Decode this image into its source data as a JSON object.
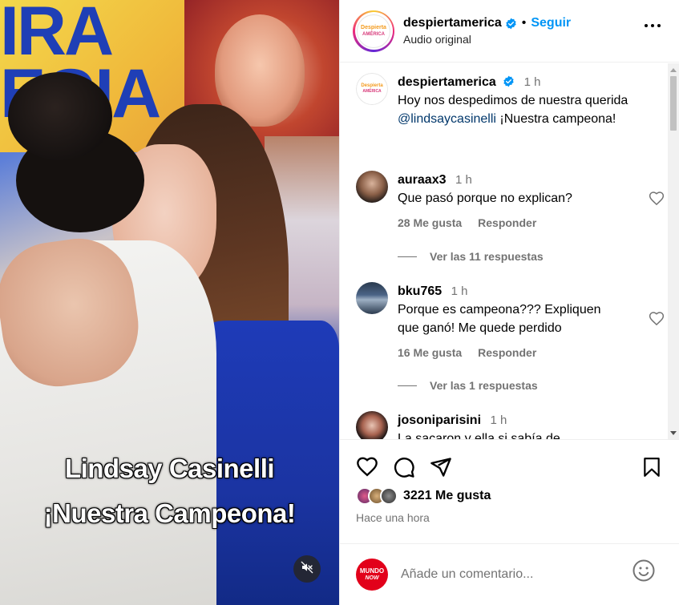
{
  "media": {
    "caption_line1": "Lindsay Casinelli",
    "caption_line2": "¡Nuestra Campeona!",
    "mute_icon": "speaker-muted-icon"
  },
  "header": {
    "username": "despiertamerica",
    "separator": "•",
    "follow_label": "Seguir",
    "audio_label": "Audio original",
    "more_icon": "more-options-icon",
    "logo_line1": "Despierta",
    "logo_line2": "AMÉRICA"
  },
  "caption": {
    "username": "despiertamerica",
    "time": "1 h",
    "text_before": "Hoy nos despedimos de nuestra querida ",
    "mention": "@lindsaycasinelli",
    "text_after": " ¡Nuestra campeona!"
  },
  "comments": [
    {
      "username": "auraax3",
      "time": "1 h",
      "text": "Que pasó porque no explican?",
      "likes": "28 Me gusta",
      "reply_label": "Responder",
      "view_replies": "Ver las 11 respuestas"
    },
    {
      "username": "bku765",
      "time": "1 h",
      "text": "Porque es campeona??? Expliquen que ganó! Me quede perdido",
      "likes": "16 Me gusta",
      "reply_label": "Responder",
      "view_replies": "Ver las 1 respuestas"
    },
    {
      "username": "josoniparisini",
      "time": "1 h",
      "text": "La sacaron y ella si sabía de"
    }
  ],
  "actions": {
    "like_icon": "heart-icon",
    "comment_icon": "comment-icon",
    "share_icon": "share-icon",
    "save_icon": "bookmark-icon",
    "likes_count": "3221 Me gusta",
    "posted_time": "Hace una hora"
  },
  "add_comment": {
    "placeholder": "Añade un comentario...",
    "avatar_line1": "MUNDO",
    "avatar_line2": "NOW",
    "emoji_icon": "emoji-icon"
  },
  "colors": {
    "link_blue": "#0095f6",
    "mention_blue": "#00376b",
    "secondary_text": "#737373",
    "verified_blue": "#0095f6"
  }
}
